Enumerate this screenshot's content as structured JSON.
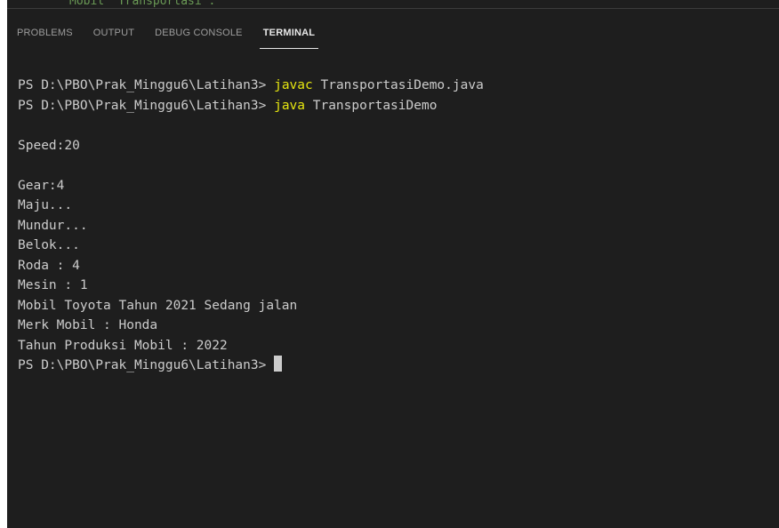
{
  "editor": {
    "ghost_text": "Mobil  Transportasi :"
  },
  "tabs": [
    {
      "label": "PROBLEMS",
      "active": false
    },
    {
      "label": "OUTPUT",
      "active": false
    },
    {
      "label": "DEBUG CONSOLE",
      "active": false
    },
    {
      "label": "TERMINAL",
      "active": true
    }
  ],
  "terminal": {
    "lines": [
      {
        "prompt": "PS D:\\PBO\\Prak_Minggu6\\Latihan3> ",
        "command": "javac",
        "args": " TransportasiDemo.java"
      },
      {
        "prompt": "PS D:\\PBO\\Prak_Minggu6\\Latihan3> ",
        "command": "java",
        "args": " TransportasiDemo"
      },
      {
        "text": ""
      },
      {
        "text": "Speed:20"
      },
      {
        "text": ""
      },
      {
        "text": "Gear:4"
      },
      {
        "text": "Maju..."
      },
      {
        "text": "Mundur..."
      },
      {
        "text": "Belok..."
      },
      {
        "text": "Roda : 4"
      },
      {
        "text": "Mesin : 1"
      },
      {
        "text": "Mobil Toyota Tahun 2021 Sedang jalan"
      },
      {
        "text": "Merk Mobil : Honda"
      },
      {
        "text": "Tahun Produksi Mobil : 2022"
      }
    ],
    "final_prompt": "PS D:\\PBO\\Prak_Minggu6\\Latihan3> "
  },
  "colors": {
    "background": "#1e1e1e",
    "text": "#cccccc",
    "command": "#e5e510",
    "tab_inactive": "#9d9d9d",
    "tab_active": "#e7e7e7"
  }
}
